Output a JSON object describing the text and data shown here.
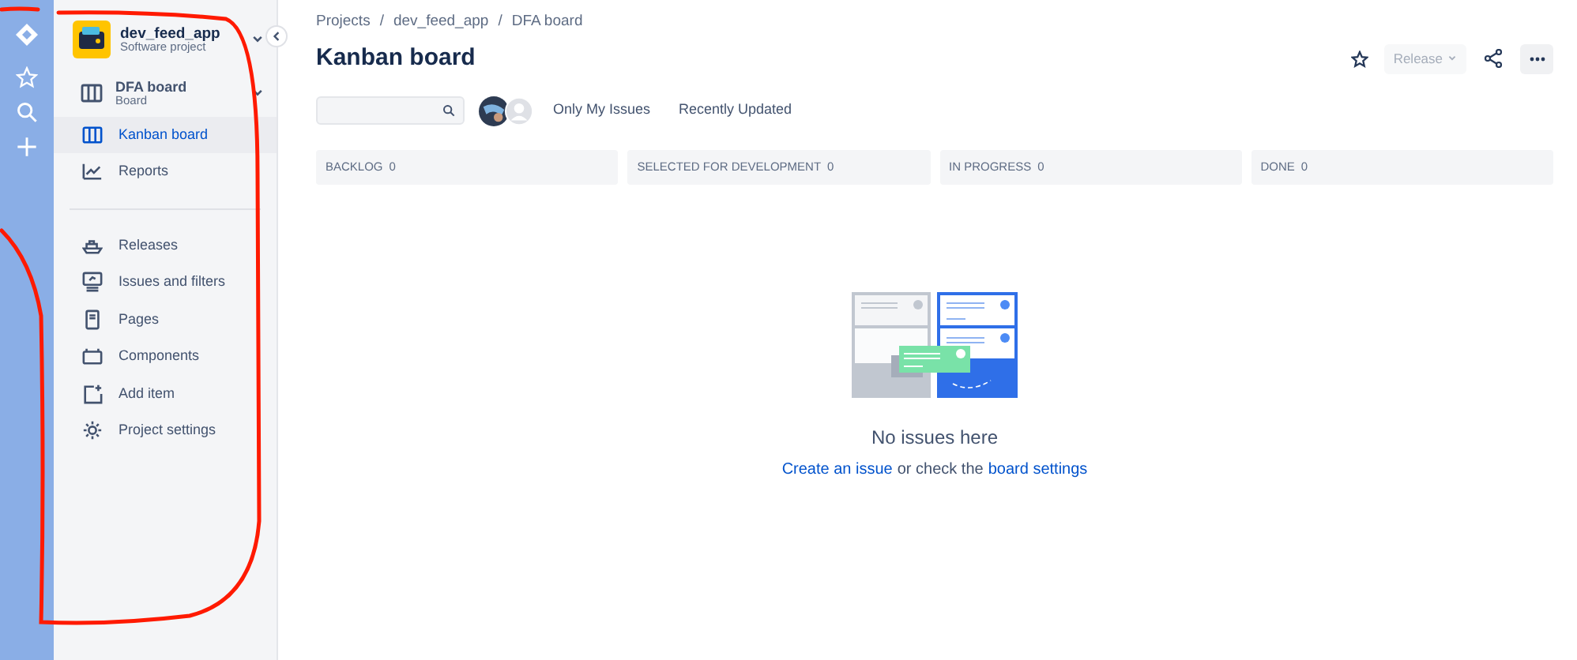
{
  "project": {
    "name": "dev_feed_app",
    "type": "Software project"
  },
  "board_switcher": {
    "name": "DFA board",
    "subtitle": "Board"
  },
  "sidebar": {
    "board_items": [
      {
        "label": "Kanban board",
        "selected": true
      },
      {
        "label": "Reports",
        "selected": false
      }
    ],
    "project_items": [
      {
        "label": "Releases",
        "selected": false
      },
      {
        "label": "Issues and filters",
        "selected": false
      },
      {
        "label": "Pages",
        "selected": false
      },
      {
        "label": "Components",
        "selected": false
      },
      {
        "label": "Add item",
        "selected": false
      },
      {
        "label": "Project settings",
        "selected": false
      }
    ]
  },
  "breadcrumbs": {
    "links": [
      "Projects",
      "dev_feed_app",
      "DFA board"
    ],
    "separators": [
      "/",
      "/"
    ]
  },
  "page_title": "Kanban board",
  "header_actions": {
    "release": {
      "label": "Release",
      "disabled": true
    }
  },
  "filters": [
    {
      "label": "Only My Issues"
    },
    {
      "label": "Recently Updated"
    }
  ],
  "columns": [
    {
      "name": "BACKLOG",
      "count": "0"
    },
    {
      "name": "SELECTED FOR DEVELOPMENT",
      "count": "0"
    },
    {
      "name": "IN PROGRESS",
      "count": "0"
    },
    {
      "name": "DONE",
      "count": "0"
    }
  ],
  "empty_state": {
    "title": "No issues here",
    "message": [
      {
        "kind": "link",
        "text": "Create an issue"
      },
      {
        "kind": "text",
        "text": "or check the"
      },
      {
        "kind": "link",
        "text": "board settings"
      }
    ]
  }
}
